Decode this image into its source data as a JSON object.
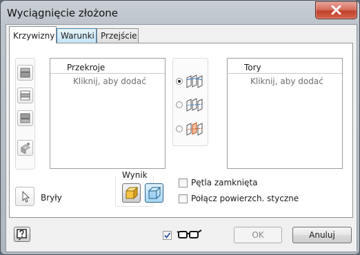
{
  "window": {
    "title": "Wyciągnięcie złożone"
  },
  "tabs": [
    {
      "label": "Krzywizny",
      "active": true
    },
    {
      "label": "Warunki",
      "active": false
    },
    {
      "label": "Przejście",
      "active": false
    }
  ],
  "sections_list": {
    "header": "Przekroje",
    "placeholder": "Kliknij, aby dodać"
  },
  "rails_list": {
    "header": "Tory",
    "placeholder": "Kliknij, aby dodać"
  },
  "profile_tools": [
    "section-add-icon",
    "section-insert-icon",
    "section-remove-icon",
    "auto-map-icon"
  ],
  "modes": [
    {
      "name": "rails-mode",
      "selected": true
    },
    {
      "name": "center-line-mode",
      "selected": false
    },
    {
      "name": "area-loft-mode",
      "selected": false
    }
  ],
  "output": {
    "group_label": "Wynik",
    "solids_label": "Bryły",
    "solid_selected": false,
    "surface_selected": true
  },
  "options": {
    "closed_loop_label": "Pętla zamknięta",
    "closed_loop_checked": false,
    "merge_tangent_label": "Połącz powierzch. styczne",
    "merge_tangent_checked": false
  },
  "footer": {
    "preview_checked": true,
    "ok_label": "OK",
    "cancel_label": "Anuluj"
  },
  "colors": {
    "accent": "#3c7fb1",
    "close": "#c0422d",
    "solid": "#f5c242"
  }
}
